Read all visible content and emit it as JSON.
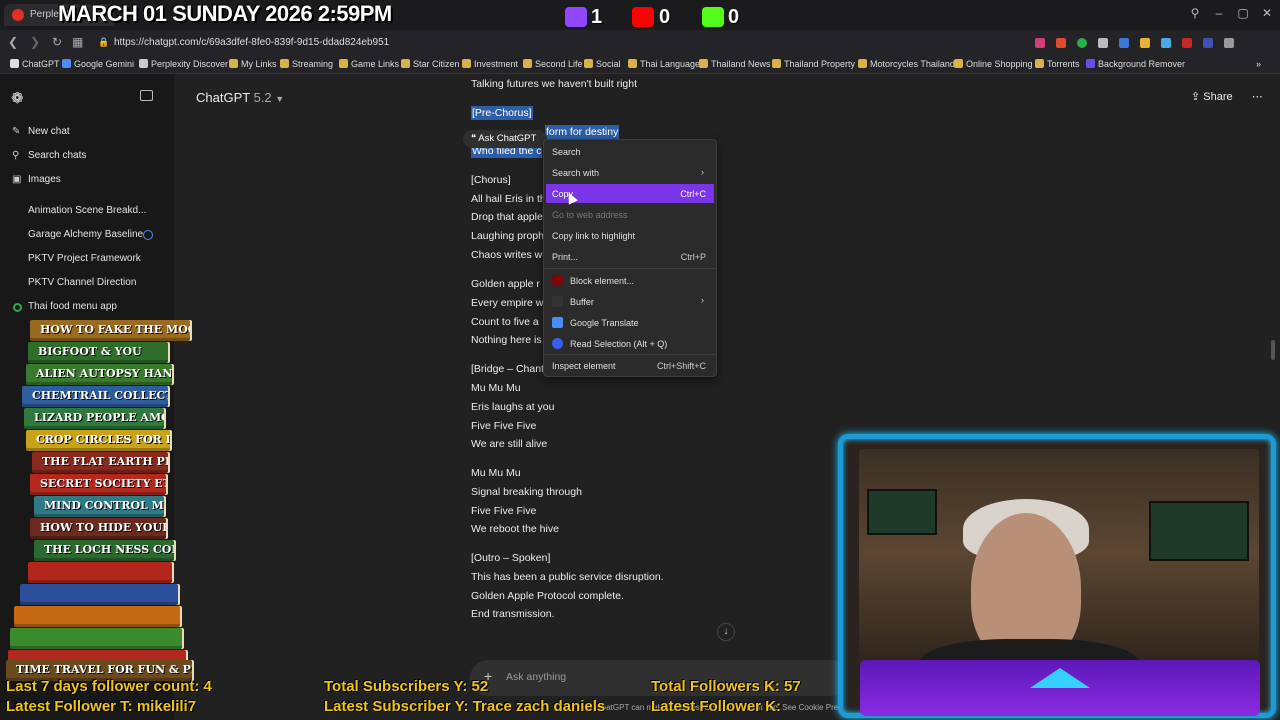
{
  "browser": {
    "tab_title": "Perplexity",
    "url": "https://chatgpt.com/c/69a3dfef-8fe0-839f-9d15-ddad824eb951",
    "bookmarks": [
      "ChatGPT",
      "Google Gemini",
      "Perplexity Discover",
      "My Links",
      "Streaming",
      "Game Links",
      "Star Citizen",
      "Investment",
      "Second Life",
      "Social",
      "Thai Language",
      "Thailand News",
      "Thailand Property",
      "Motorcycles Thailand",
      "Online Shopping",
      "Torrents",
      "Background Remover"
    ]
  },
  "sidebar": {
    "items": [
      {
        "label": "New chat",
        "icon": "edit-icon"
      },
      {
        "label": "Search chats",
        "icon": "search-icon"
      },
      {
        "label": "Images",
        "icon": "image-icon"
      }
    ],
    "chats": [
      "Animation Scene Breakd...",
      "Garage Alchemy Baseline",
      "PKTV Project Framework",
      "PKTV Channel Direction",
      "Thai food menu app"
    ]
  },
  "header": {
    "model": "ChatGPT",
    "version": "5.2",
    "share_label": "Share"
  },
  "content": {
    "lines": [
      "Talking futures we haven't built right",
      "[Pre-Chorus]",
      "form for destiny",
      "Who filed the c",
      "[Chorus]",
      "All hail Eris in th",
      "Drop that apple",
      "Laughing prophe",
      "Chaos writes w",
      "Golden apple r",
      "Every empire w",
      "Count to five a",
      "Nothing here is",
      "[Bridge – Chant",
      "Mu Mu Mu",
      "Eris laughs at you",
      "Five Five Five",
      "We are still alive",
      "Mu Mu Mu",
      "Signal breaking through",
      "Five Five Five",
      "We reboot the hive",
      "[Outro – Spoken]",
      "This has been a public service disruption.",
      "Golden Apple Protocol complete.",
      "End transmission."
    ],
    "ask_chatgpt": "Ask ChatGPT",
    "composer_placeholder": "Ask anything",
    "disclaimer": "ChatGPT can make mistakes. Check important info. See Cookie Preferences."
  },
  "context_menu": {
    "items": [
      {
        "label": "Search",
        "shortcut": ""
      },
      {
        "label": "Search with",
        "shortcut": "",
        "submenu": true
      },
      {
        "label": "Copy",
        "shortcut": "Ctrl+C",
        "highlighted": true
      },
      {
        "label": "Go to web address",
        "shortcut": "",
        "disabled": true
      },
      {
        "label": "Copy link to highlight",
        "shortcut": ""
      },
      {
        "label": "Print...",
        "shortcut": "Ctrl+P"
      },
      {
        "label": "Block element...",
        "shortcut": "",
        "icon": "ublock-icon"
      },
      {
        "label": "Buffer",
        "shortcut": "",
        "submenu": true
      },
      {
        "label": "Google Translate",
        "shortcut": "",
        "icon": "translate-icon"
      },
      {
        "label": "Read Selection (Alt + Q)",
        "shortcut": "",
        "icon": "read-aloud-icon"
      },
      {
        "label": "Inspect element",
        "shortcut": "Ctrl+Shift+C"
      }
    ]
  },
  "overlay": {
    "datetime": "MARCH 01 SUNDAY 2026 2:59PM",
    "twitch_count": "1",
    "youtube_count": "0",
    "kick_count": "0",
    "follower_count_7d": "Last 7 days follower count: 4",
    "latest_follower_t": "Latest Follower T: mikelili7",
    "total_subscribers_y": "Total Subscribers Y: 52",
    "latest_subscriber_y": "Latest Subscriber Y: Trace zach daniels",
    "total_followers_k": "Total Followers K: 57",
    "latest_follower_k": "Latest Follower K:",
    "books": [
      {
        "title": "HOW TO FAKE THE MOON LANDING",
        "color": "#9a6a1e"
      },
      {
        "title": "BIGFOOT & YOU",
        "color": "#2f6e2a"
      },
      {
        "title": "ALIEN AUTOPSY HANDBOOK",
        "color": "#3a7a2c"
      },
      {
        "title": "CHEMTRAIL COLLECTION GUIDE",
        "color": "#2d5fa0"
      },
      {
        "title": "LIZARD PEOPLE AMONG US",
        "color": "#2f7a3a"
      },
      {
        "title": "CROP CIRCLES FOR DUMMIES",
        "color": "#c9a21a"
      },
      {
        "title": "THE FLAT EARTH PRIMER",
        "color": "#8a2a1e"
      },
      {
        "title": "SECRET SOCIETY ETIQUETTE",
        "color": "#b5281c"
      },
      {
        "title": "MIND CONTROL MADE EASY",
        "color": "#2e7a86"
      },
      {
        "title": "HOW TO HIDE YOUR BUNKER",
        "color": "#6a2a1e"
      },
      {
        "title": "THE LOCH NESS CONSPIRACY",
        "color": "#2a6a2e"
      },
      {
        "title": "",
        "color": "#b3261c"
      },
      {
        "title": "",
        "color": "#2c4f9a"
      },
      {
        "title": "",
        "color": "#c56a12"
      },
      {
        "title": "",
        "color": "#3a8a2e"
      },
      {
        "title": "",
        "color": "#b3281e"
      },
      {
        "title": "TIME TRAVEL FOR FUN & PROFIT",
        "color": "#6b4a1e"
      }
    ]
  }
}
